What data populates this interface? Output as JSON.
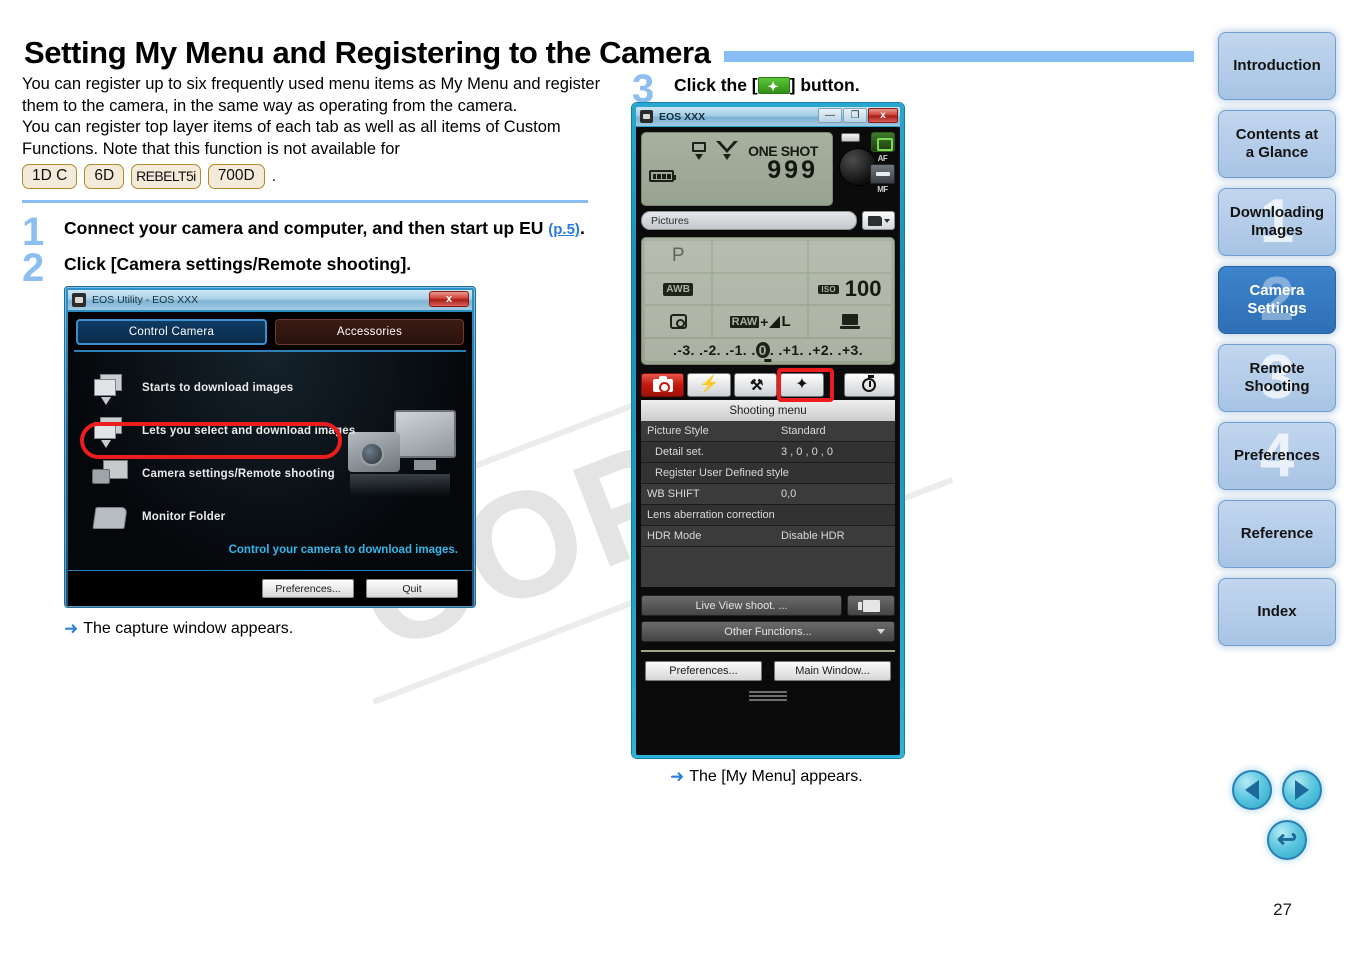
{
  "header": {
    "title": "Setting My Menu and Registering to the Camera"
  },
  "intro": {
    "para1": "You can register up to six frequently used menu items as My Menu and register them to the camera, in the same way as operating from the camera.",
    "para2": "You can register top layer items of each tab as well as all items of Custom Functions. Note that this function is not available for",
    "badges": [
      "1D C",
      "6D",
      "REBELT5i",
      "700D"
    ],
    "badge_trailing": "."
  },
  "steps": [
    {
      "num": "1",
      "text_before": "Connect your camera and computer, and then start up EU ",
      "link": "(p.5)",
      "text_after": "."
    },
    {
      "num": "2",
      "text_before": "Click [Camera settings/Remote shooting].",
      "link": "",
      "text_after": ""
    },
    {
      "num": "3",
      "text_before": "Click the [",
      "link": "",
      "text_after": "] button."
    }
  ],
  "notes": {
    "capture_window": "The capture window appears.",
    "my_menu": "The [My Menu] appears.",
    "arrow_glyph": "➜"
  },
  "eos_utility": {
    "title": "EOS Utility  -  EOS XXX",
    "close_label": "x",
    "tabs": [
      {
        "label": "Control Camera",
        "state": "active"
      },
      {
        "label": "Accessories",
        "state": "inactive"
      }
    ],
    "rows": [
      {
        "label": "Starts to download images",
        "icon": "stack-download-icon"
      },
      {
        "label": "Lets you select and download images",
        "icon": "stack-select-icon"
      },
      {
        "label": "Camera settings/Remote shooting",
        "icon": "camera-monitor-icon"
      },
      {
        "label": "Monitor Folder",
        "icon": "folder-icon"
      }
    ],
    "caption": "Control your camera to download images.",
    "buttons": [
      "Preferences...",
      "Quit"
    ]
  },
  "capture_window": {
    "title": "EOS XXX",
    "win_buttons": {
      "minimize": "—",
      "maximize": "❐",
      "close": "x"
    },
    "lcd": {
      "drive_mode_icon": "single-shot-icon",
      "metering_icon": "af-point-icon",
      "af_mode": "ONE SHOT",
      "shots_remaining": "999",
      "battery_icon": "battery-full-icon",
      "af_label": "AF",
      "mf_label": "MF"
    },
    "folder": {
      "value": "Pictures",
      "button_icon": "folder-browse-icon"
    },
    "settings_lcd": {
      "shooting_mode": "P",
      "white_balance": "AWB",
      "iso_tag": "ISO",
      "iso_value": "100",
      "metering_icon": "evaluative-metering-icon",
      "quality_raw": "RAW",
      "quality_plus": "+",
      "quality_large": "L",
      "destination_icon": "pc-transfer-icon",
      "exposure_scale": ".-3. .-2. .-1. .",
      "exposure_zero": "0",
      "exposure_scale_right": ". .+1. .+2. .+3."
    },
    "tabs": [
      {
        "name": "shooting-tab",
        "icon": "camera-icon",
        "state": "active"
      },
      {
        "name": "flash-tab",
        "icon": "flash-icon",
        "state": "normal"
      },
      {
        "name": "setup-tab",
        "icon": "wrench-icon",
        "state": "normal"
      },
      {
        "name": "my-menu-tab",
        "icon": "my-menu-star-icon",
        "state": "highlighted"
      },
      {
        "name": "timer-tab",
        "icon": "timer-icon",
        "state": "normal"
      }
    ],
    "menu_title": "Shooting menu",
    "menu_rows": [
      {
        "label": "Picture Style",
        "value": "Standard"
      },
      {
        "label": "Detail set.",
        "value": "3 , 0 , 0 , 0",
        "indent": true
      },
      {
        "label": "Register User Defined style",
        "value": "",
        "indent": true
      },
      {
        "label": "WB SHIFT",
        "value": "0,0"
      },
      {
        "label": "Lens aberration correction",
        "value": ""
      },
      {
        "label": "HDR Mode",
        "value": "Disable HDR"
      }
    ],
    "live_view_button": "Live View shoot. ...",
    "movie_button_icon": "movie-icon",
    "other_functions_button": "Other Functions...",
    "footer_buttons": [
      "Preferences...",
      "Main Window..."
    ]
  },
  "sidebar": {
    "items": [
      {
        "label": "Introduction",
        "number": "",
        "active": false
      },
      {
        "label": "Contents at\na Glance",
        "line1": "Contents at",
        "line2": "a Glance",
        "number": "",
        "active": false
      },
      {
        "label": "Downloading Images",
        "line1": "Downloading",
        "line2": "Images",
        "number": "1",
        "active": false
      },
      {
        "label": "Camera Settings",
        "line1": "Camera",
        "line2": "Settings",
        "number": "2",
        "active": true
      },
      {
        "label": "Remote Shooting",
        "line1": "Remote",
        "line2": "Shooting",
        "number": "3",
        "active": false
      },
      {
        "label": "Preferences",
        "line1": "Preferences",
        "line2": "",
        "number": "4",
        "active": false
      },
      {
        "label": "Reference",
        "line1": "Reference",
        "line2": "",
        "number": "",
        "active": false
      },
      {
        "label": "Index",
        "line1": "Index",
        "line2": "",
        "number": "",
        "active": false
      }
    ]
  },
  "pagenav": {
    "prev_icon": "previous-page-icon",
    "next_icon": "next-page-icon",
    "back_icon": "go-back-icon"
  },
  "page_number": "27",
  "watermark": "COPY",
  "colors": {
    "accent_blue": "#87bdf5",
    "link_blue": "#2a7de1",
    "highlight_red": "#ee1d1d",
    "badge_border": "#b08a26",
    "active_nav": "#3d84cc"
  }
}
